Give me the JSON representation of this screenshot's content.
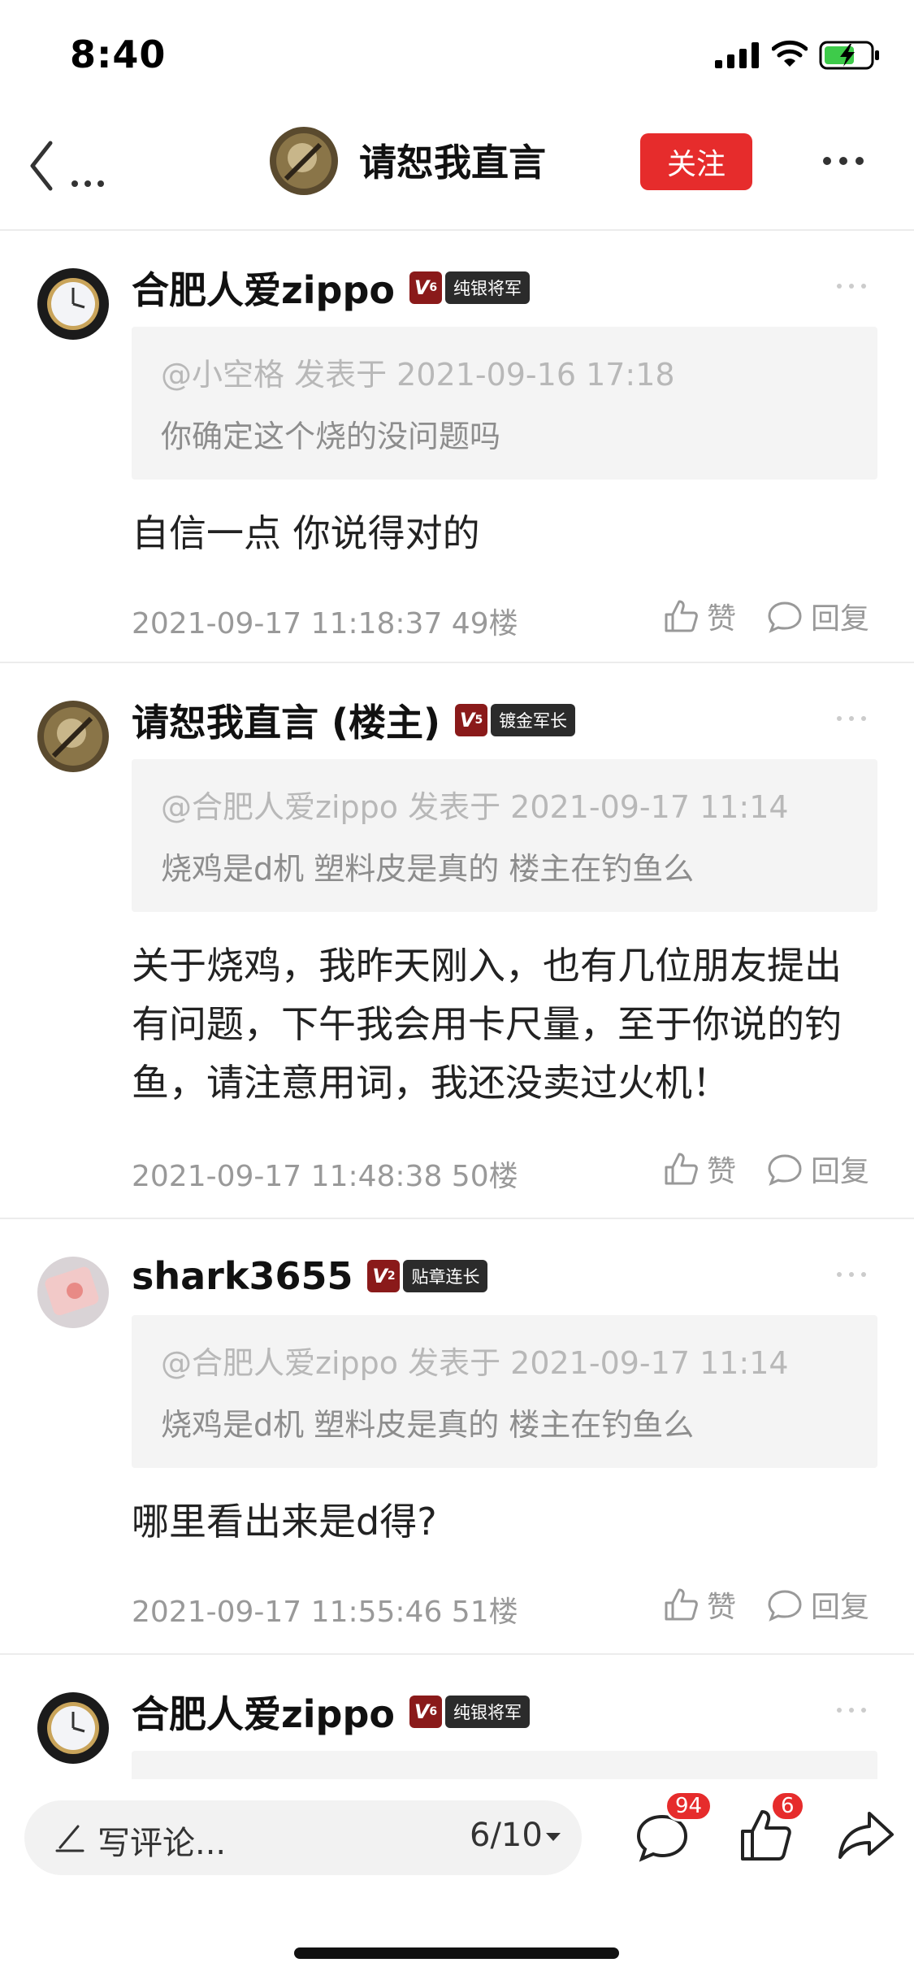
{
  "status": {
    "time": "8:40"
  },
  "nav": {
    "title": "请恕我直言",
    "follow": "关注"
  },
  "comments": [
    {
      "user": "合肥人爱zippo",
      "level": "V",
      "level_num": "6",
      "title": "纯银将军",
      "quote_meta": "@小空格 发表于 2021-09-16 17:18",
      "quote_text": "你确定这个烧的没问题吗",
      "text": "自信一点 你说得对的",
      "time_floor": "2021-09-17 11:18:37  49楼",
      "like": "赞",
      "reply": "回复"
    },
    {
      "user": "请恕我直言 (楼主)",
      "level": "V",
      "level_num": "5",
      "title": "镀金军长",
      "quote_meta": "@合肥人爱zippo 发表于 2021-09-17 11:14",
      "quote_text": "烧鸡是d机 塑料皮是真的  楼主在钓鱼么",
      "text": "关于烧鸡，我昨天刚入，也有几位朋友提出有问题，下午我会用卡尺量，至于你说的钓鱼，请注意用词，我还没卖过火机！",
      "time_floor": "2021-09-17 11:48:38  50楼",
      "like": "赞",
      "reply": "回复"
    },
    {
      "user": "shark3655",
      "level": "V",
      "level_num": "2",
      "title": "贴章连长",
      "quote_meta": "@合肥人爱zippo 发表于 2021-09-17 11:14",
      "quote_text": "烧鸡是d机 塑料皮是真的  楼主在钓鱼么",
      "text": "哪里看出来是d得?",
      "time_floor": "2021-09-17 11:55:46  51楼",
      "like": "赞",
      "reply": "回复"
    },
    {
      "user": "合肥人爱zippo",
      "level": "V",
      "level_num": "6",
      "title": "纯银将军"
    }
  ],
  "bottom": {
    "placeholder": "写评论...",
    "pager": "6/10",
    "comment_count": "94",
    "like_count": "6"
  },
  "colors": {
    "accent": "#e62c2c",
    "level_badge": "#8a1a1a",
    "title_badge": "#2b2b2b"
  },
  "icons": [
    "back-icon",
    "more-icon",
    "like-icon",
    "reply-icon",
    "pencil-icon",
    "comment-icon",
    "thumb-icon",
    "share-icon"
  ]
}
